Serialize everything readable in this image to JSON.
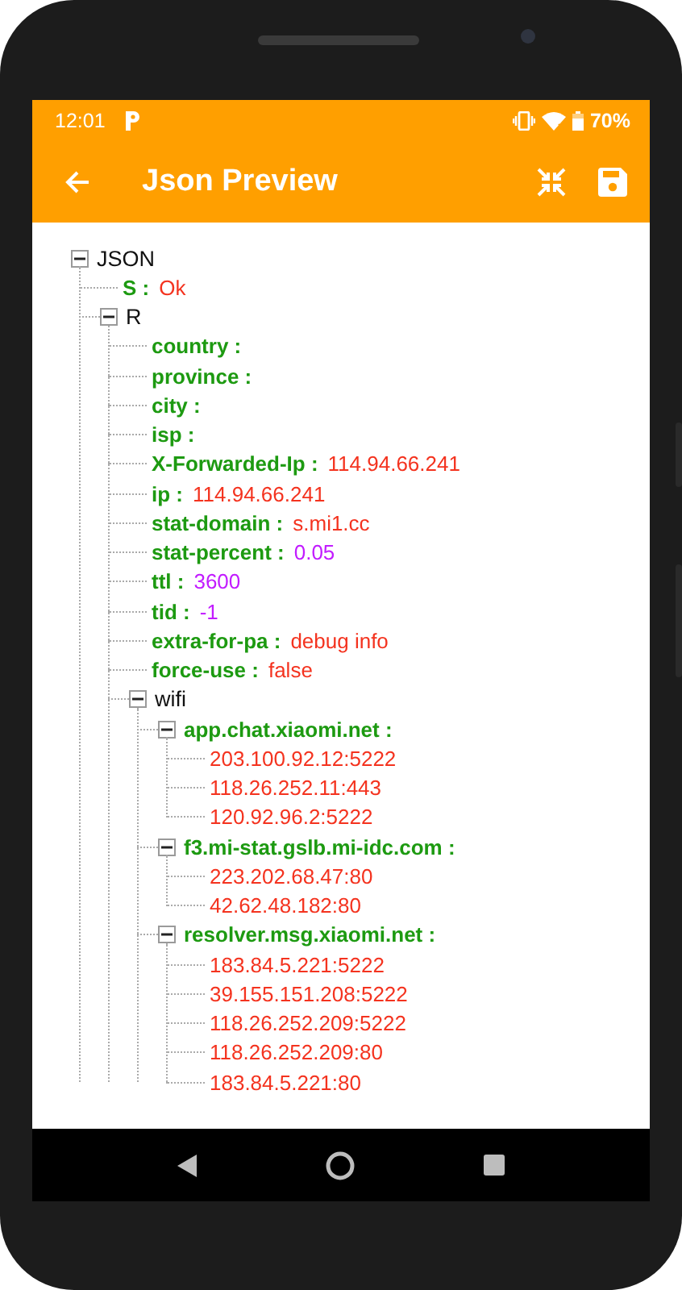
{
  "status_bar": {
    "time": "12:01",
    "battery": "70%"
  },
  "toolbar": {
    "title": "Json Preview"
  },
  "tree": {
    "kind": "object",
    "label": "JSON",
    "expanded": true,
    "children": [
      {
        "kind": "pair",
        "key": "S :",
        "value": "Ok",
        "color": "#f4331f"
      },
      {
        "kind": "object",
        "label": "R",
        "expanded": true,
        "children": [
          {
            "kind": "pair",
            "key": "country :"
          },
          {
            "kind": "pair",
            "key": "province :"
          },
          {
            "kind": "pair",
            "key": "city :"
          },
          {
            "kind": "pair",
            "key": "isp :"
          },
          {
            "kind": "pair",
            "key": "X-Forwarded-Ip :",
            "value": "114.94.66.241",
            "color": "#f4331f"
          },
          {
            "kind": "pair",
            "key": "ip :",
            "value": "114.94.66.241",
            "color": "#f4331f"
          },
          {
            "kind": "pair",
            "key": "stat-domain :",
            "value": "s.mi1.cc",
            "color": "#f4331f"
          },
          {
            "kind": "pair",
            "key": "stat-percent :",
            "value": "0.05",
            "color": "#c21cff"
          },
          {
            "kind": "pair",
            "key": "ttl :",
            "value": "3600",
            "color": "#c21cff"
          },
          {
            "kind": "pair",
            "key": "tid :",
            "value": "-1",
            "color": "#c21cff"
          },
          {
            "kind": "pair",
            "key": "extra-for-pa :",
            "value": "debug info",
            "color": "#f4331f"
          },
          {
            "kind": "pair",
            "key": "force-use :",
            "value": "false",
            "color": "#f4331f"
          },
          {
            "kind": "object",
            "label": "wifi",
            "expanded": true,
            "children": [
              {
                "kind": "array",
                "label": "app.chat.xiaomi.net :",
                "expanded": true,
                "children": [
                  {
                    "kind": "item",
                    "value": "203.100.92.12:5222"
                  },
                  {
                    "kind": "item",
                    "value": "118.26.252.11:443"
                  },
                  {
                    "kind": "item",
                    "value": "120.92.96.2:5222"
                  }
                ]
              },
              {
                "kind": "array",
                "label": "f3.mi-stat.gslb.mi-idc.com :",
                "expanded": true,
                "children": [
                  {
                    "kind": "item",
                    "value": "223.202.68.47:80"
                  },
                  {
                    "kind": "item",
                    "value": "42.62.48.182:80"
                  }
                ]
              },
              {
                "kind": "array",
                "label": "resolver.msg.xiaomi.net :",
                "expanded": true,
                "children": [
                  {
                    "kind": "item",
                    "value": "183.84.5.221:5222"
                  },
                  {
                    "kind": "item",
                    "value": "39.155.151.208:5222"
                  },
                  {
                    "kind": "item",
                    "value": "118.26.252.209:5222"
                  },
                  {
                    "kind": "item",
                    "value": "118.26.252.209:80"
                  },
                  {
                    "kind": "item",
                    "value": "183.84.5.221:80"
                  }
                ]
              }
            ]
          }
        ]
      }
    ]
  }
}
